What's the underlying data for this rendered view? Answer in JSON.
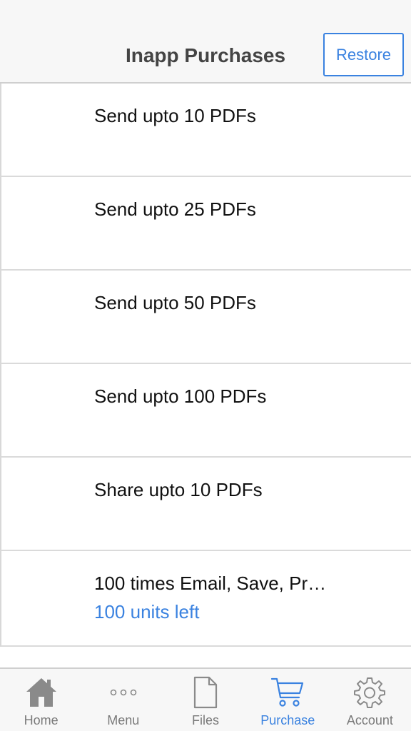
{
  "header": {
    "title": "Inapp Purchases",
    "restore_label": "Restore"
  },
  "purchases": [
    {
      "title": "Send upto 10 PDFs",
      "subtitle": ""
    },
    {
      "title": "Send upto 25 PDFs",
      "subtitle": ""
    },
    {
      "title": "Send upto 50 PDFs",
      "subtitle": ""
    },
    {
      "title": "Send upto 100 PDFs",
      "subtitle": ""
    },
    {
      "title": "Share upto 10 PDFs",
      "subtitle": ""
    },
    {
      "title": "100 times Email, Save, Pr…",
      "subtitle": "100 units left"
    }
  ],
  "tabs": [
    {
      "label": "Home",
      "icon": "home-icon",
      "active": false
    },
    {
      "label": "Menu",
      "icon": "more-icon",
      "active": false
    },
    {
      "label": "Files",
      "icon": "file-icon",
      "active": false
    },
    {
      "label": "Purchase",
      "icon": "cart-icon",
      "active": true
    },
    {
      "label": "Account",
      "icon": "gear-icon",
      "active": false
    }
  ],
  "colors": {
    "accent": "#3a82e0",
    "inactive": "#7a7a7a",
    "bar_background": "#f7f7f7"
  }
}
